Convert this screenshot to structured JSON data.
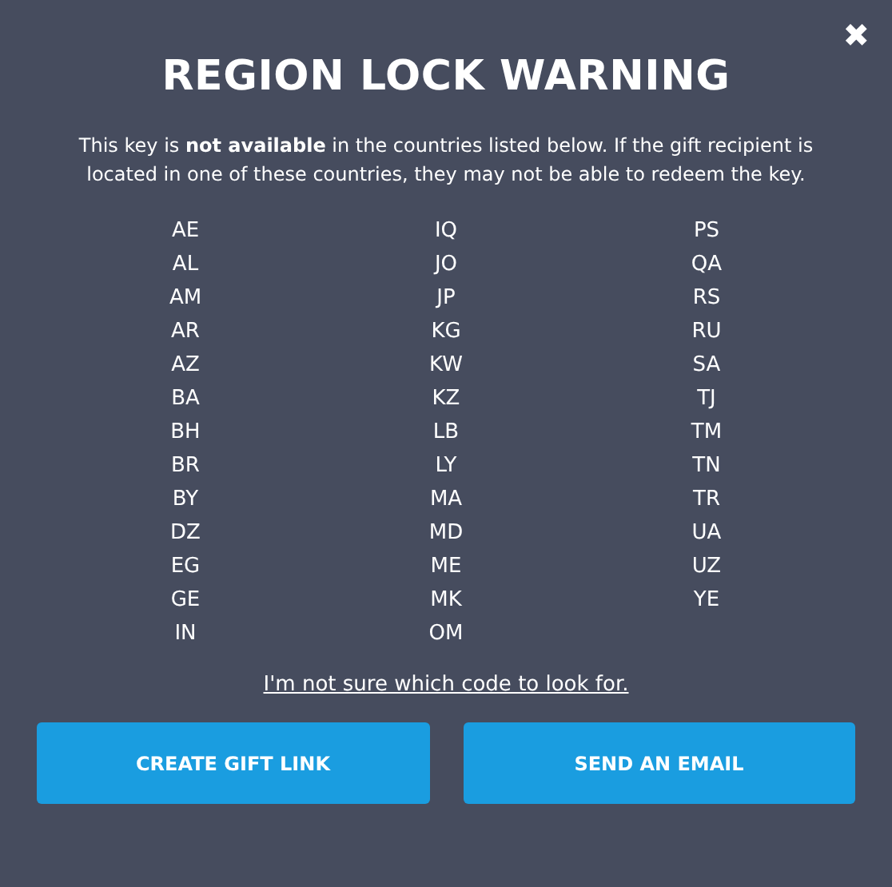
{
  "close_label": "✖",
  "title": "REGION LOCK WARNING",
  "description": "This key is **not available** in the countries listed below. If the gift recipient is located in one of these countries, they may not be able to redeem the key.",
  "country_columns": [
    [
      "AE",
      "AL",
      "AM",
      "AR",
      "AZ",
      "BA",
      "BH",
      "BR",
      "BY",
      "DZ",
      "EG",
      "GE",
      "IN"
    ],
    [
      "IQ",
      "JO",
      "JP",
      "KG",
      "KW",
      "KZ",
      "LB",
      "LY",
      "MA",
      "MD",
      "ME",
      "MK",
      "OM"
    ],
    [
      "PS",
      "QA",
      "RS",
      "RU",
      "SA",
      "TJ",
      "TM",
      "TN",
      "TR",
      "UA",
      "UZ",
      "YE"
    ]
  ],
  "help_link": "I'm not sure which code to look for.",
  "buttons": [
    "CREATE GIFT LINK",
    "SEND AN EMAIL"
  ]
}
